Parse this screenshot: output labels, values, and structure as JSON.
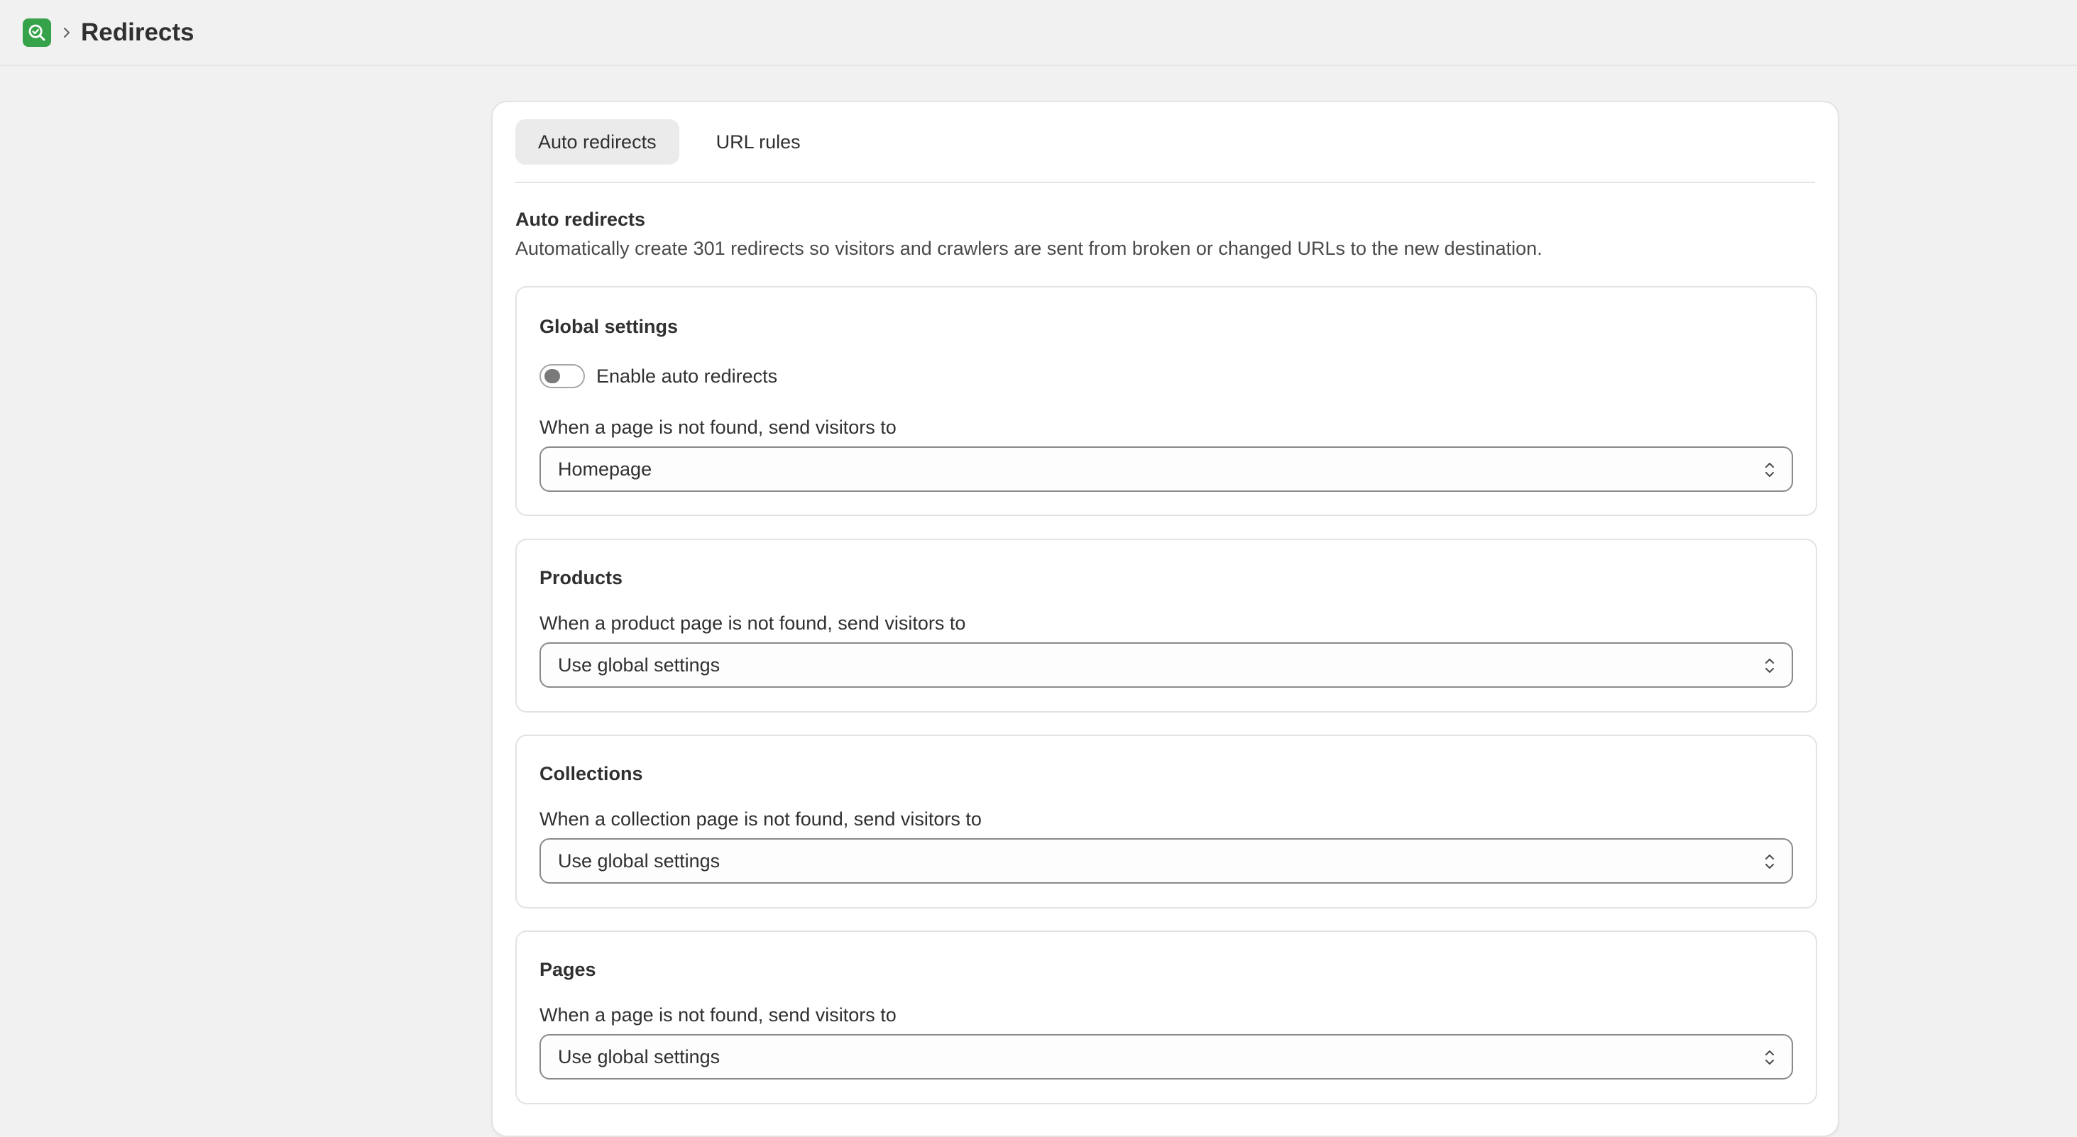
{
  "header": {
    "title": "Redirects",
    "breadcrumb_separator": "›"
  },
  "tabs": [
    {
      "label": "Auto redirects",
      "active": true
    },
    {
      "label": "URL rules",
      "active": false
    }
  ],
  "section": {
    "heading": "Auto redirects",
    "description": "Automatically create 301 redirects so visitors and crawlers are sent from broken or changed URLs to the new destination."
  },
  "global_settings": {
    "title": "Global settings",
    "toggle_label": "Enable auto redirects",
    "toggle_on": false,
    "field_label": "When a page is not found, send visitors to",
    "selected": "Homepage"
  },
  "products": {
    "title": "Products",
    "field_label": "When a product page is not found, send visitors to",
    "selected": "Use global settings"
  },
  "collections": {
    "title": "Collections",
    "field_label": "When a collection page is not found, send visitors to",
    "selected": "Use global settings"
  },
  "pages": {
    "title": "Pages",
    "field_label": "When a page is not found, send visitors to",
    "selected": "Use global settings"
  },
  "colors": {
    "app_logo": "#36a24a",
    "background": "#f1f1f1",
    "active_tab": "#ebebeb"
  },
  "icons": {
    "app_logo": "search-check-icon",
    "breadcrumb": "chevron-right-icon",
    "select": "select-chevrons-icon"
  }
}
